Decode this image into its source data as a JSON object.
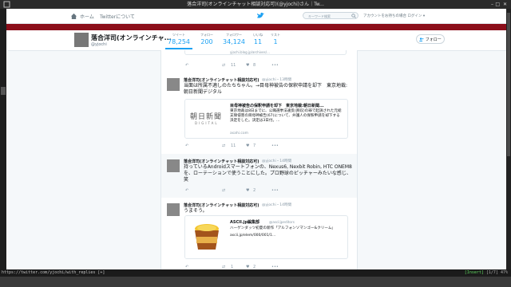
{
  "window": {
    "title": "落合洋司(オンラインチャット相談対応可)(@yjochi)さん｜Tw..."
  },
  "nav": {
    "home": "ホーム",
    "about": "Twitterについて",
    "search_placeholder": "キーワード検索",
    "account": "アカウントをお持ちの場合 ログイン ▾"
  },
  "profile": {
    "name": "落合洋司(オンラインチャ...",
    "handle": "@yjochi",
    "stats": [
      {
        "label": "ツイート",
        "value": "78,254"
      },
      {
        "label": "フォロー",
        "value": "200"
      },
      {
        "label": "フォロワー",
        "value": "34,124"
      },
      {
        "label": "いいね",
        "value": "11"
      },
      {
        "label": "リスト",
        "value": "1"
      }
    ],
    "follow_label": "フォロー"
  },
  "tweets": [
    {
      "top_url": "yjochi.blog.jp/archives/...",
      "counts": {
        "retweet": "11",
        "like": "8"
      }
    },
    {
      "name": "落合洋司(オンラインチャット相談対応可)",
      "handle": "@yjochi・13時間",
      "text": "当面は所属不適しのたちちゃん。→目母神被告の保釈申請を却下　東京地裁: 朝日新聞デジタル",
      "card": {
        "title": "目母神被告の保釈申請を却下　東京地裁:朝日新聞...",
        "desc": "東京地裁は8日までに、公職選挙法違反(買収)の罪で起訴された元総支障侵害の目母神被告(67)について、弁護人の保釈申請を却下する決定をした。決定は3日付。...",
        "url": "asahi.com",
        "logo_top": "朝日新聞",
        "logo_bottom": "DIGITAL"
      },
      "counts": {
        "retweet": "11",
        "like": "7"
      }
    },
    {
      "name": "落合洋司(オンラインチャット相談対応可)",
      "handle": "@yjochi・14時間",
      "text": "持っているAndroidスマートフォンの、Nexus6, Nexbit Robin, HTC ONEM8を、ローテーションで使うことにした。プロ野球のピッチャーみたいな感じ、笑",
      "counts": {
        "retweet": "",
        "like": "2"
      }
    },
    {
      "name": "落合洋司(オンラインチャット相談対応可)",
      "handle": "@yjochi・14時間",
      "text": "うまそう。",
      "card": {
        "title": "ASCII.jp編集部",
        "handle": "@asciijpeditors",
        "desc": "ハーゲンダッツ初夏の新作「アルフォンソマンゴー&クリーム」",
        "url": "ascii.jp/elem/000/001/1..."
      },
      "counts": {
        "retweet": "1",
        "like": "2"
      }
    }
  ],
  "statusbar": {
    "url": "https://twitter.com/yjochi/with_replies [+]",
    "state": "[Insert]",
    "pos": "[1/7] 47%"
  }
}
